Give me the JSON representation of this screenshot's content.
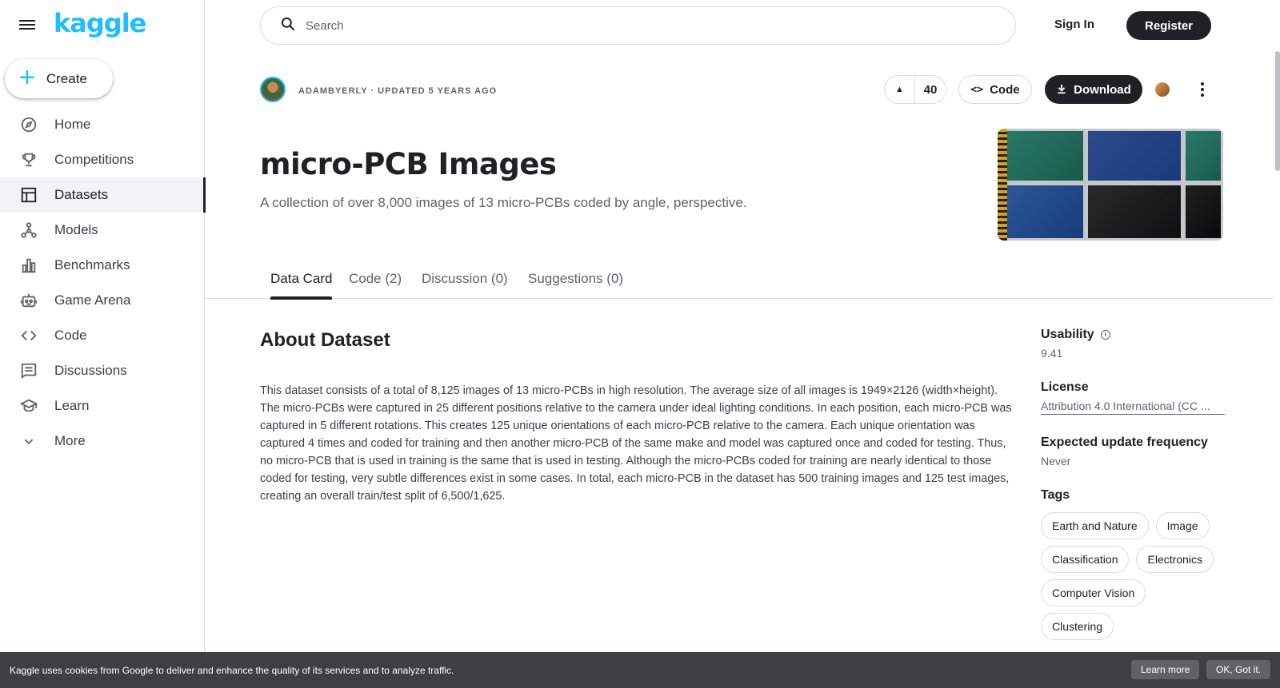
{
  "sidebar": {
    "logo": "kaggle",
    "create_label": "Create",
    "items": [
      {
        "label": "Home",
        "icon": "compass-icon"
      },
      {
        "label": "Competitions",
        "icon": "trophy-icon"
      },
      {
        "label": "Datasets",
        "icon": "table-icon"
      },
      {
        "label": "Models",
        "icon": "models-icon"
      },
      {
        "label": "Benchmarks",
        "icon": "bar-chart-icon"
      },
      {
        "label": "Game Arena",
        "icon": "robot-icon"
      },
      {
        "label": "Code",
        "icon": "code-icon"
      },
      {
        "label": "Discussions",
        "icon": "comment-icon"
      },
      {
        "label": "Learn",
        "icon": "school-icon"
      },
      {
        "label": "More",
        "icon": "chevron-down-icon"
      }
    ],
    "active": "Datasets"
  },
  "header": {
    "search_placeholder": "Search",
    "sign_in": "Sign In",
    "register": "Register"
  },
  "dataset": {
    "owner_meta": "ADAMBYERLY · UPDATED 5 YEARS AGO",
    "votes": "40",
    "code_label": "Code",
    "download_label": "Download",
    "title": "micro-PCB Images",
    "subtitle": "A collection of over 8,000 images of 13 micro-PCBs coded by angle, perspective."
  },
  "tabs": [
    "Data Card",
    "Code (2)",
    "Discussion (0)",
    "Suggestions (0)"
  ],
  "about": {
    "heading": "About Dataset",
    "text": "This dataset consists of a total of 8,125 images of 13 micro-PCBs in high resolution. The average size of all images is 1949×2126 (width×height). The micro-PCBs were captured in 25 different positions relative to the camera under ideal lighting conditions. In each position, each micro-PCB was captured in 5 different rotations. This creates 125 unique orientations of each micro-PCB relative to the camera. Each unique orientation was captured 4 times and coded for training and then another micro-PCB of the same make and model was captured once and coded for testing. Thus, no micro-PCB that is used in training is the same that is used in testing. Although the micro-PCBs coded for training are nearly identical to those coded for testing, very subtle differences exist in some cases. In total, each micro-PCB in the dataset has 500 training images and 125 test images, creating an overall train/test split of 6,500/1,625."
  },
  "meta_panel": {
    "usability_label": "Usability",
    "usability_value": "9.41",
    "license_label": "License",
    "license_value": "Attribution 4.0 International (CC ...",
    "frequency_label": "Expected update frequency",
    "frequency_value": "Never",
    "tags_label": "Tags",
    "tags": [
      "Earth and Nature",
      "Image",
      "Classification",
      "Electronics",
      "Computer Vision",
      "Clustering"
    ]
  },
  "cookie": {
    "message": "Kaggle uses cookies from Google to deliver and enhance the quality of its services and to analyze traffic.",
    "learn_more": "Learn more",
    "ok": "OK, Got it."
  }
}
